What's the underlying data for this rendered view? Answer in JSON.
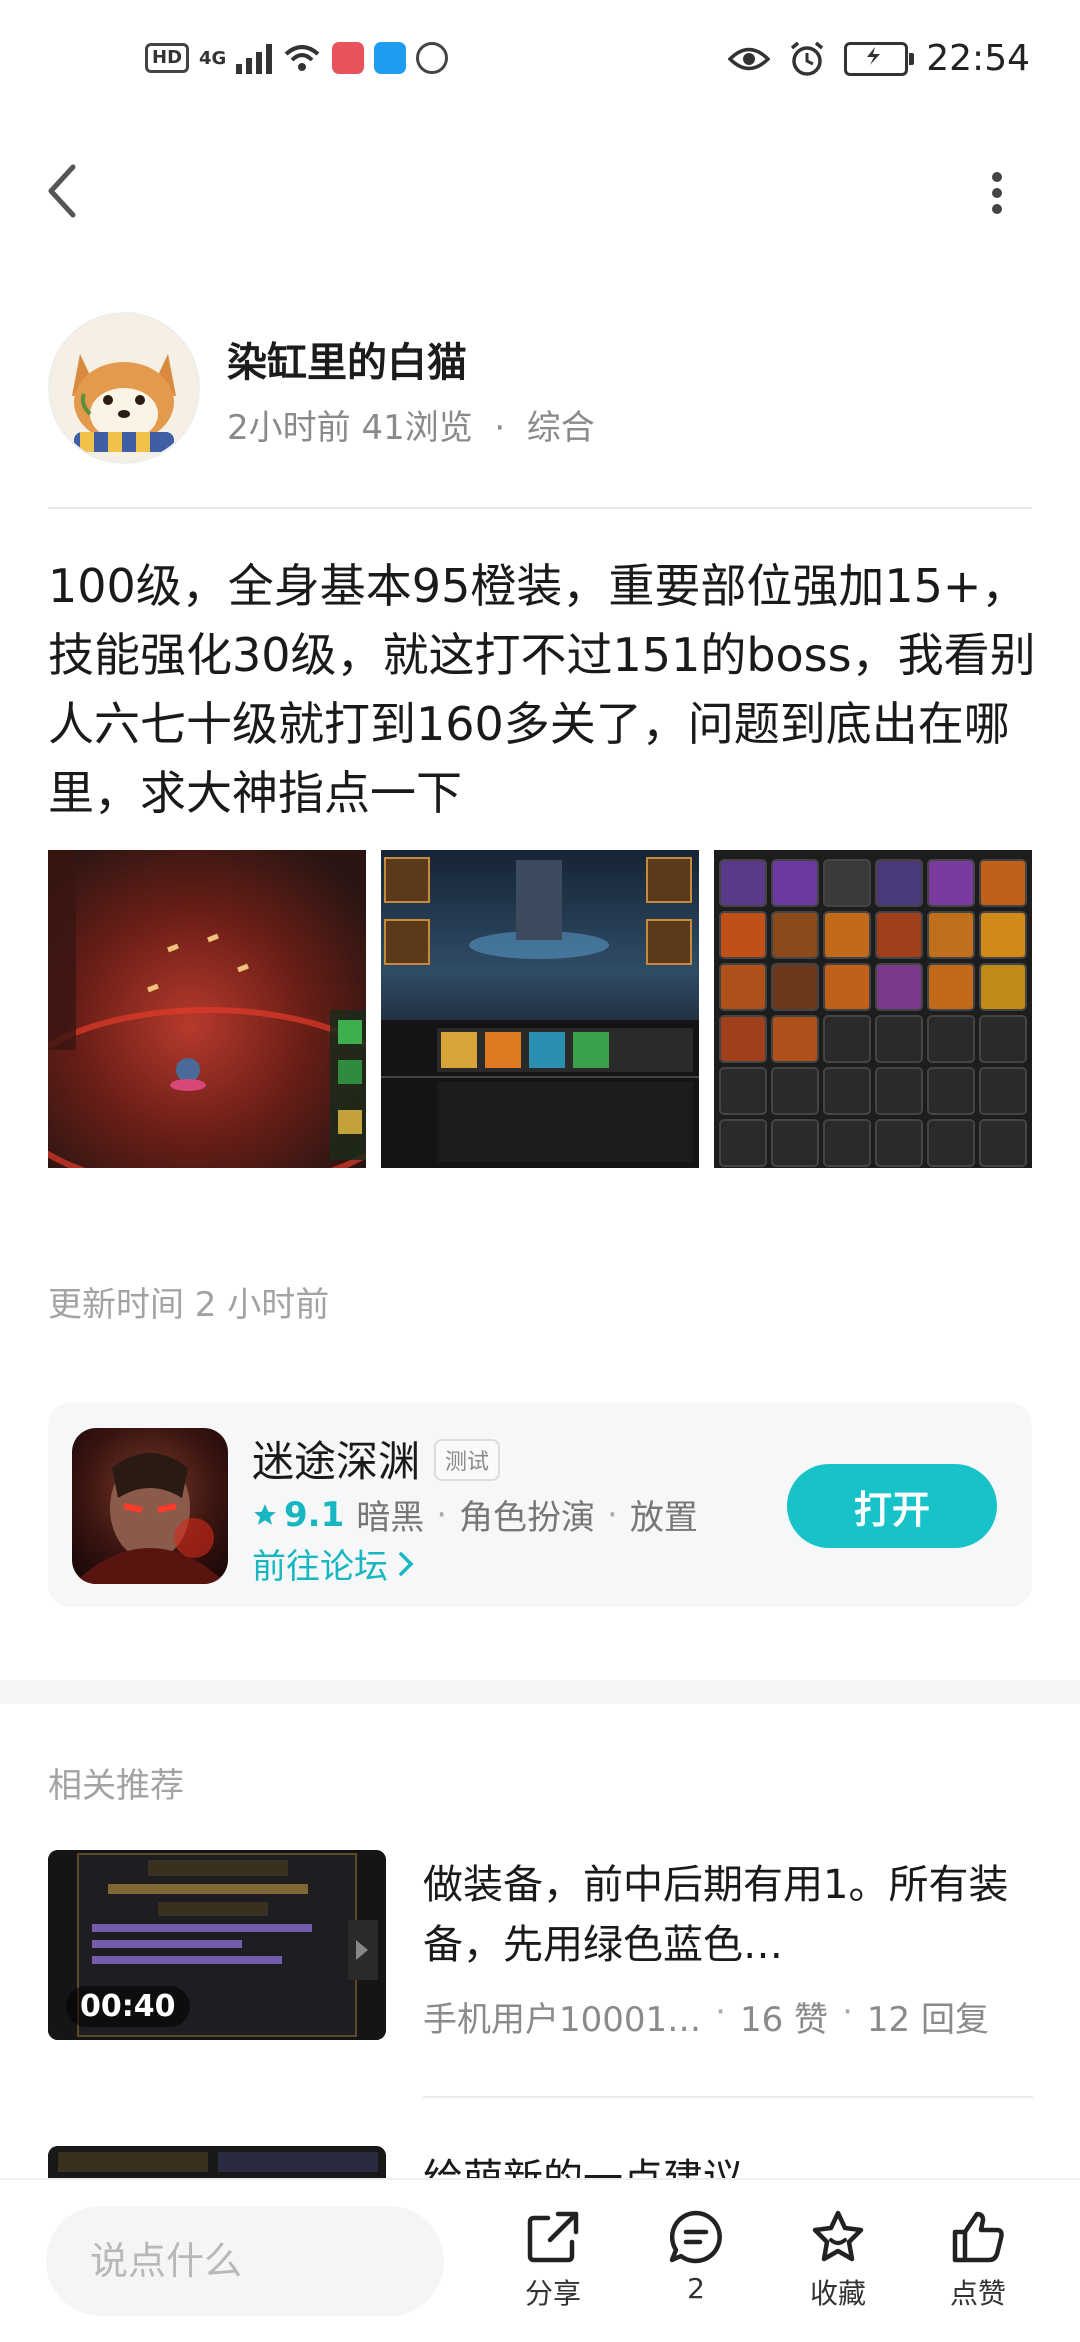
{
  "status_bar": {
    "hd": "HD",
    "network": "4G",
    "time": "22:54"
  },
  "author": {
    "name": "染缸里的白猫",
    "time_ago": "2小时前",
    "views": "41浏览",
    "separator": "·",
    "category": "综合"
  },
  "post": {
    "text": "100级，全身基本95橙装，重要部位强加15+，技能强化30级，就这打不过151的boss，我看别人六七十级就打到160多关了，问题到底出在哪里，求大神指点一下",
    "update_time": "更新时间 2 小时前"
  },
  "game": {
    "name": "迷途深渊",
    "badge": "测试",
    "rating": "9.1",
    "tags": [
      "暗黑",
      "角色扮演",
      "放置"
    ],
    "forum_link": "前往论坛",
    "open_label": "打开"
  },
  "related": {
    "title": "相关推荐",
    "items": [
      {
        "duration": "00:40",
        "title": "做装备，前中后期有用1。所有装备，先用绿色蓝色…",
        "author": "手机用户10001…",
        "likes": "16 赞",
        "replies": "12 回复"
      },
      {
        "title": "给萌新的一点建议"
      }
    ]
  },
  "bottom_bar": {
    "comment_placeholder": "说点什么",
    "share_label": "分享",
    "comment_count": "2",
    "favorite_label": "收藏",
    "like_label": "点赞"
  },
  "colors": {
    "accent": "#17c3c9",
    "link": "#17b6c1"
  }
}
